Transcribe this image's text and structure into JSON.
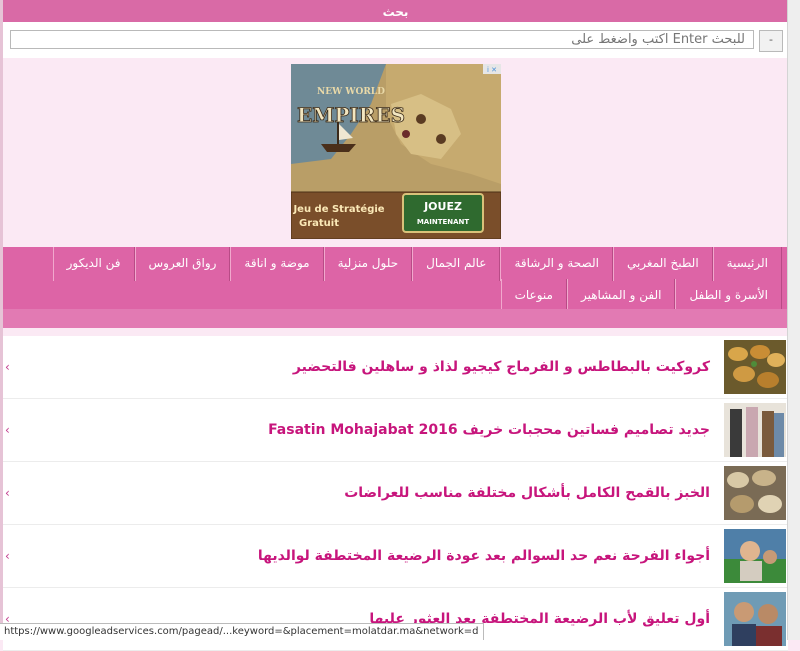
{
  "search": {
    "header": "بحث",
    "placeholder": "اكتب واضغط على Enter للبحث",
    "button_label": "-"
  },
  "ad": {
    "game_title_top": "NEW WORLD",
    "game_title": "EMPIRES",
    "tagline_line1": "Jeu de Stratégie",
    "tagline_line2": "Gratuit",
    "cta_line1": "JOUEZ",
    "cta_line2": "MAINTENANT"
  },
  "nav": {
    "row1": [
      "الرئيسية",
      "الطبخ المغربي",
      "الصحة و الرشاقة",
      "عالم الجمال",
      "حلول منزلية",
      "موضة و اناقة",
      "رواق العروس",
      "فن الديكور"
    ],
    "row2": [
      "الأسرة و الطفل",
      "الفن و المشاهير",
      "منوعات"
    ]
  },
  "articles": [
    {
      "title": "كروكيت بالبطاطس و الفرماج كيجيو لذاذ و ساهلين فالتحضير"
    },
    {
      "title": "جديد تصاميم فساتين محجبات خريف Fasatin Mohajabat 2016"
    },
    {
      "title": "الخبز بالقمح الكامل بأشكال مختلفة مناسب للعراضات"
    },
    {
      "title": "أجواء الفرحة نعم حد السوالم بعد عودة الرضيعة المختطفة لوالديها"
    },
    {
      "title": "أول تعليق لأب الرضيعة المختطفة بعد العثور عليها"
    }
  ],
  "chevron": "‹",
  "status_bar": "https://www.googleadservices.com/pagead/...keyword=&placement=molatdar.ma&network=d",
  "colors": {
    "accent": "#dd64a6",
    "title": "#c7157c",
    "background": "#fbe9f4"
  }
}
